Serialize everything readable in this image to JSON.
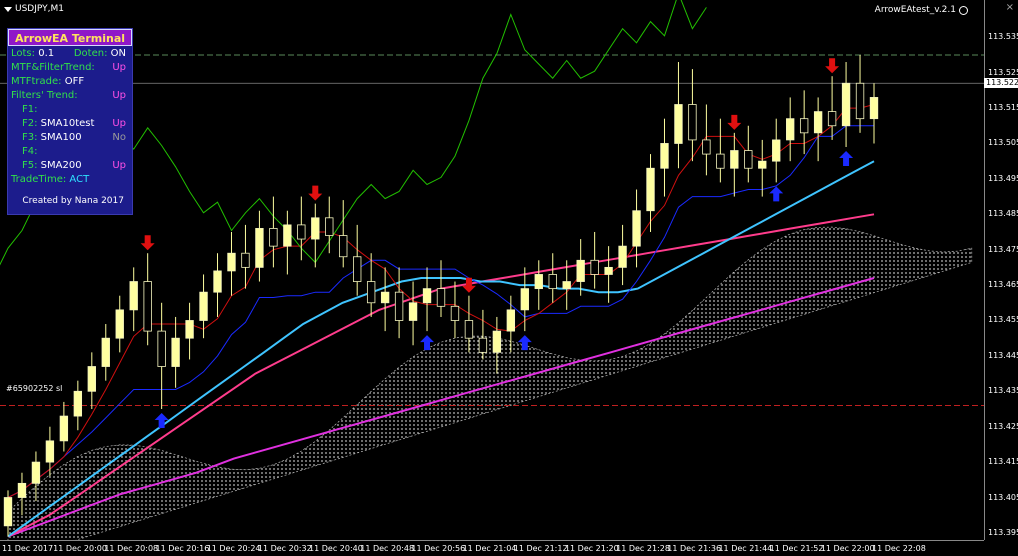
{
  "window": {
    "symbol": "USDJPY,M1",
    "ea_name": "ArrowEAtest_v.2.1",
    "close_glyph": "×"
  },
  "panel": {
    "title": "ArrowEA Terminal",
    "lots_label": "Lots:",
    "lots_value": "0.1",
    "doten_label": "Doten:",
    "doten_value": "ON",
    "mtf_filter_label": "MTF&FilterTrend:",
    "mtf_filter_value": "Up",
    "mtftrade_label": "MTFtrade:",
    "mtftrade_value": "OFF",
    "filters_trend_label": "Filters' Trend:",
    "filters_trend_value": "Up",
    "filters": [
      {
        "label": "F1:",
        "name": "",
        "value": ""
      },
      {
        "label": "F2:",
        "name": "SMA10test",
        "value": "Up"
      },
      {
        "label": "F3:",
        "name": "SMA100",
        "value": "No"
      },
      {
        "label": "F4:",
        "name": "",
        "value": ""
      },
      {
        "label": "F5:",
        "name": "SMA200",
        "value": "Up"
      }
    ],
    "tradetime_label": "TradeTime:",
    "tradetime_value": "ACT",
    "footer": "Created by Nana 2017"
  },
  "price_axis": {
    "ticks": [
      "113.535",
      "113.525",
      "113.515",
      "113.505",
      "113.495",
      "113.485",
      "113.475",
      "113.465",
      "113.455",
      "113.445",
      "113.435",
      "113.425",
      "113.415",
      "113.405",
      "113.395"
    ],
    "current_price": "113.522"
  },
  "line_label": "#65902252 sl",
  "time_axis": {
    "ticks": [
      "11 Dec 2017",
      "11 Dec 20:00",
      "11 Dec 20:08",
      "11 Dec 20:16",
      "11 Dec 20:24",
      "11 Dec 20:32",
      "11 Dec 20:40",
      "11 Dec 20:48",
      "11 Dec 20:56",
      "11 Dec 21:04",
      "11 Dec 21:12",
      "11 Dec 21:20",
      "11 Dec 21:28",
      "11 Dec 21:36",
      "11 Dec 21:44",
      "11 Dec 21:52",
      "11 Dec 22:00",
      "11 Dec 22:08"
    ]
  },
  "colors": {
    "bull": "#ffffa0",
    "bear": "#f5f5c0",
    "sma_fast": "#3fc4ff",
    "sma_mid": "#ff3c8c",
    "sma_slow": "#e030e0",
    "kijun": "#1a2aff",
    "tenkan": "#d01010",
    "chikou": "#22c000",
    "cloud": "#ffffff",
    "arrow_up": "#1a2aff",
    "arrow_down": "#e01010",
    "sl_line": "#c02020",
    "dash_line": "#5a8a5a"
  },
  "chart_data": {
    "type": "candlestick",
    "symbol": "USDJPY",
    "timeframe": "M1",
    "ylim": [
      113.393,
      113.541
    ],
    "current_price": 113.522,
    "stop_loss_level": 113.431,
    "upper_dash_level": 113.53,
    "ohlc": [
      [
        113.397,
        113.407,
        113.394,
        113.405
      ],
      [
        113.405,
        113.412,
        113.4,
        113.409
      ],
      [
        113.409,
        113.418,
        113.404,
        113.415
      ],
      [
        113.415,
        113.425,
        113.411,
        113.421
      ],
      [
        113.421,
        113.432,
        113.418,
        113.428
      ],
      [
        113.428,
        113.438,
        113.424,
        113.435
      ],
      [
        113.435,
        113.446,
        113.43,
        113.442
      ],
      [
        113.442,
        113.454,
        113.438,
        113.45
      ],
      [
        113.45,
        113.462,
        113.446,
        113.458
      ],
      [
        113.458,
        113.47,
        113.452,
        113.466
      ],
      [
        113.466,
        113.474,
        113.448,
        113.452
      ],
      [
        113.452,
        113.46,
        113.43,
        113.442
      ],
      [
        113.442,
        113.456,
        113.436,
        113.45
      ],
      [
        113.45,
        113.46,
        113.444,
        113.455
      ],
      [
        113.455,
        113.468,
        113.45,
        113.463
      ],
      [
        113.463,
        113.474,
        113.456,
        113.469
      ],
      [
        113.469,
        113.48,
        113.462,
        113.474
      ],
      [
        113.474,
        113.482,
        113.464,
        113.47
      ],
      [
        113.47,
        113.486,
        113.466,
        113.481
      ],
      [
        113.481,
        113.49,
        113.47,
        113.476
      ],
      [
        113.476,
        113.486,
        113.468,
        113.482
      ],
      [
        113.482,
        113.49,
        113.472,
        113.478
      ],
      [
        113.478,
        113.488,
        113.47,
        113.484
      ],
      [
        113.484,
        113.49,
        113.474,
        113.479
      ],
      [
        113.479,
        113.489,
        113.47,
        113.473
      ],
      [
        113.473,
        113.482,
        113.462,
        113.466
      ],
      [
        113.466,
        113.474,
        113.456,
        113.46
      ],
      [
        113.46,
        113.47,
        113.452,
        113.463
      ],
      [
        113.463,
        113.47,
        113.45,
        113.455
      ],
      [
        113.455,
        113.466,
        113.448,
        113.46
      ],
      [
        113.46,
        113.47,
        113.452,
        113.464
      ],
      [
        113.464,
        113.472,
        113.456,
        113.459
      ],
      [
        113.459,
        113.466,
        113.45,
        113.455
      ],
      [
        113.455,
        113.462,
        113.446,
        113.45
      ],
      [
        113.45,
        113.458,
        113.444,
        113.446
      ],
      [
        113.446,
        113.456,
        113.44,
        113.452
      ],
      [
        113.452,
        113.462,
        113.446,
        113.458
      ],
      [
        113.458,
        113.47,
        113.452,
        113.464
      ],
      [
        113.464,
        113.472,
        113.458,
        113.468
      ],
      [
        113.468,
        113.474,
        113.46,
        113.464
      ],
      [
        113.464,
        113.472,
        113.458,
        113.466
      ],
      [
        113.466,
        113.478,
        113.462,
        113.472
      ],
      [
        113.472,
        113.48,
        113.464,
        113.468
      ],
      [
        113.468,
        113.476,
        113.46,
        113.47
      ],
      [
        113.47,
        113.482,
        113.465,
        113.476
      ],
      [
        113.476,
        113.492,
        113.47,
        113.486
      ],
      [
        113.486,
        113.502,
        113.48,
        113.498
      ],
      [
        113.498,
        113.512,
        113.49,
        113.505
      ],
      [
        113.505,
        113.528,
        113.498,
        113.516
      ],
      [
        113.516,
        113.526,
        113.5,
        113.506
      ],
      [
        113.506,
        113.516,
        113.496,
        113.502
      ],
      [
        113.502,
        113.512,
        113.494,
        113.498
      ],
      [
        113.498,
        113.508,
        113.49,
        113.503
      ],
      [
        113.503,
        113.51,
        113.494,
        113.498
      ],
      [
        113.498,
        113.506,
        113.49,
        113.5
      ],
      [
        113.5,
        113.512,
        113.494,
        113.506
      ],
      [
        113.506,
        113.518,
        113.5,
        113.512
      ],
      [
        113.512,
        113.52,
        113.502,
        113.508
      ],
      [
        113.508,
        113.518,
        113.5,
        113.514
      ],
      [
        113.514,
        113.524,
        113.506,
        113.51
      ],
      [
        113.51,
        113.528,
        113.504,
        113.522
      ],
      [
        113.522,
        113.53,
        113.508,
        113.512
      ],
      [
        113.512,
        113.522,
        113.505,
        113.518
      ]
    ],
    "sma_fast": [
      113.394,
      113.398,
      113.402,
      113.406,
      113.41,
      113.414,
      113.418,
      113.422,
      113.426,
      113.43,
      113.434,
      113.438,
      113.442,
      113.446,
      113.45,
      113.454,
      113.457,
      113.46,
      113.462,
      113.464,
      113.466,
      113.467,
      113.467,
      113.467,
      113.466,
      113.466,
      113.465,
      113.465,
      113.464,
      113.464,
      113.463,
      113.463,
      113.464,
      113.467,
      113.47,
      113.473,
      113.476,
      113.479,
      113.482,
      113.485,
      113.488,
      113.491,
      113.494,
      113.497,
      113.5
    ],
    "sma_mid": [
      113.394,
      113.397,
      113.4,
      113.404,
      113.408,
      113.412,
      113.416,
      113.42,
      113.424,
      113.428,
      113.432,
      113.436,
      113.44,
      113.443,
      113.446,
      113.449,
      113.452,
      113.455,
      113.458,
      113.46,
      113.462,
      113.464,
      113.465,
      113.466,
      113.467,
      113.468,
      113.469,
      113.47,
      113.471,
      113.472,
      113.473,
      113.474,
      113.475,
      113.476,
      113.477,
      113.478,
      113.479,
      113.48,
      113.481,
      113.482,
      113.483,
      113.484,
      113.485
    ],
    "sma_slow": [
      113.394,
      113.398,
      113.402,
      113.406,
      113.409,
      113.412,
      113.416,
      113.419,
      113.422,
      113.425,
      113.428,
      113.431,
      113.434,
      113.437,
      113.44,
      113.443,
      113.446,
      113.449,
      113.452,
      113.455,
      113.458,
      113.461,
      113.464,
      113.467
    ],
    "arrows": [
      {
        "dir": "down",
        "bar": 10
      },
      {
        "dir": "up",
        "bar": 11
      },
      {
        "dir": "down",
        "bar": 22
      },
      {
        "dir": "up",
        "bar": 30
      },
      {
        "dir": "down",
        "bar": 33
      },
      {
        "dir": "up",
        "bar": 37
      },
      {
        "dir": "down",
        "bar": 52
      },
      {
        "dir": "up",
        "bar": 55
      },
      {
        "dir": "down",
        "bar": 59
      },
      {
        "dir": "up",
        "bar": 60
      }
    ]
  }
}
